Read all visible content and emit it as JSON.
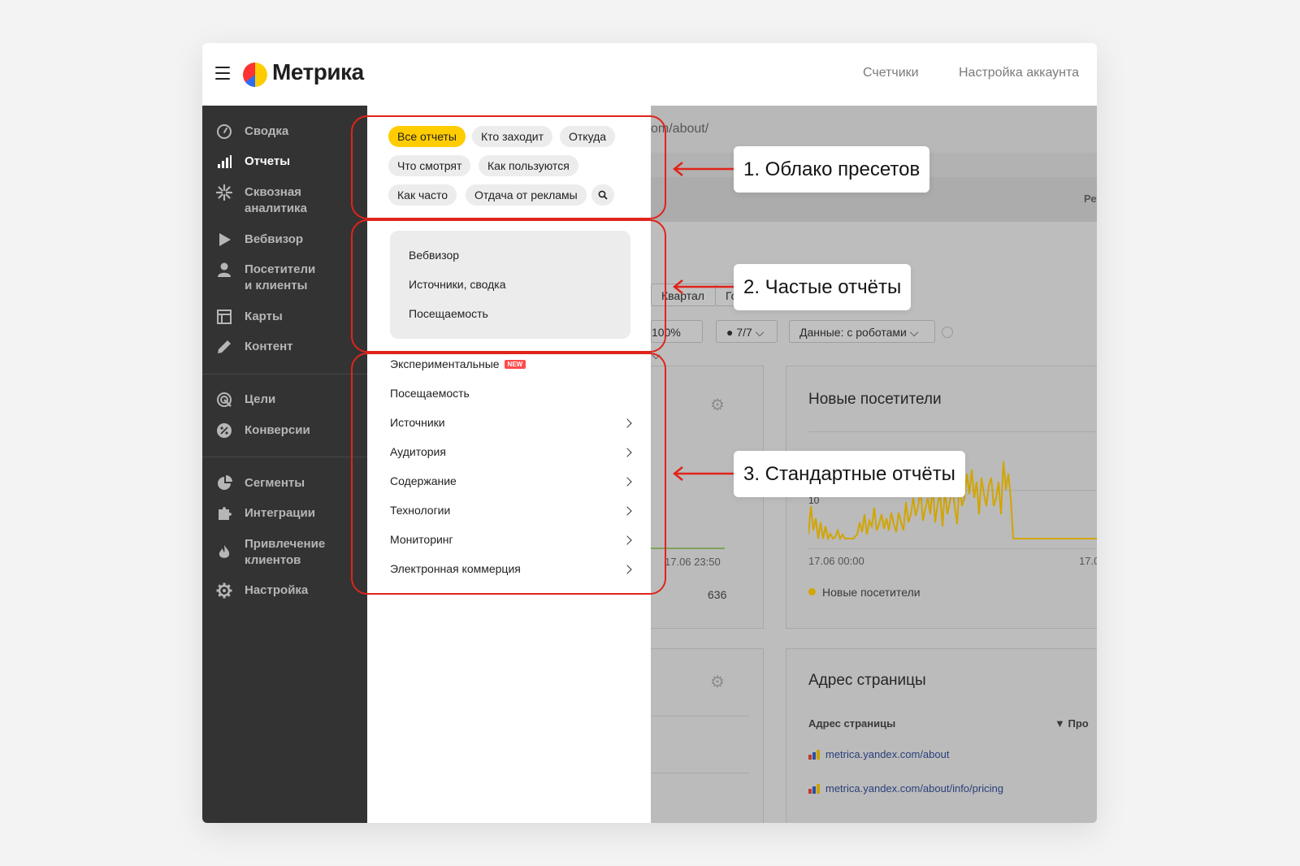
{
  "topbar": {
    "logo_text": "Метрика",
    "links": [
      "Счетчики",
      "Настройка аккаунта"
    ]
  },
  "sidebar": {
    "items": [
      {
        "label": "Сводка",
        "icon": "gauge-icon"
      },
      {
        "label": "Отчеты",
        "icon": "bar-chart-icon",
        "active": true
      },
      {
        "label": "Сквозная\nаналитика",
        "icon": "snowflake-icon"
      },
      {
        "label": "Вебвизор",
        "icon": "play-icon"
      },
      {
        "label": "Посетители\nи клиенты",
        "icon": "person-icon"
      },
      {
        "label": "Карты",
        "icon": "map-layout-icon"
      },
      {
        "label": "Контент",
        "icon": "pencil-icon"
      },
      {
        "label": "Цели",
        "icon": "target-icon"
      },
      {
        "label": "Конверсии",
        "icon": "percent-icon"
      },
      {
        "label": "Сегменты",
        "icon": "pie-icon"
      },
      {
        "label": "Интеграции",
        "icon": "puzzle-icon"
      },
      {
        "label": "Привлечение\nклиентов",
        "icon": "flame-icon"
      },
      {
        "label": "Настройка",
        "icon": "gear-icon"
      }
    ]
  },
  "menu": {
    "presets": [
      "Все отчеты",
      "Кто заходит",
      "Откуда",
      "Что смотрят",
      "Как пользуются",
      "Как часто",
      "Отдача от рекламы"
    ],
    "frequent": [
      "Вебвизор",
      "Источники, сводка",
      "Посещаемость"
    ],
    "standard": [
      {
        "label": "Экспериментальные",
        "badge": "NEW",
        "arrow": false
      },
      {
        "label": "Посещаемость",
        "arrow": false
      },
      {
        "label": "Источники",
        "arrow": true
      },
      {
        "label": "Аудитория",
        "arrow": true
      },
      {
        "label": "Содержание",
        "arrow": true
      },
      {
        "label": "Технологии",
        "arrow": true
      },
      {
        "label": "Мониторинг",
        "arrow": true
      },
      {
        "label": "Электронная коммерция",
        "arrow": true
      }
    ]
  },
  "background": {
    "url_fragment": "om/about/",
    "re_fragment": "Ре",
    "period_buttons": [
      "Квартал",
      "Го"
    ],
    "sampling": "100%",
    "attribution": "7/7",
    "robots": "Данные: с роботами",
    "card1": {
      "x_end": "17.06 23:50",
      "value": "636"
    },
    "card2": {
      "title": "Новые посетители",
      "y_tick": "10",
      "x_start": "17.06 00:00",
      "x_next": "17.0",
      "legend": "Новые посетители"
    },
    "card3": {
      "title": "Адрес страницы",
      "col1": "Адрес страницы",
      "col2": "▼ Про",
      "rows": [
        "metrica.yandex.com/about",
        "metrica.yandex.com/about/info/pricing"
      ]
    }
  },
  "callouts": [
    "1. Облако пресетов",
    "2. Частые отчёты",
    "3. Стандартные отчёты"
  ],
  "colors": {
    "accent": "#ffcc00",
    "annotation": "#e0241b",
    "sidebar": "#333333",
    "line": "#d2a500"
  }
}
